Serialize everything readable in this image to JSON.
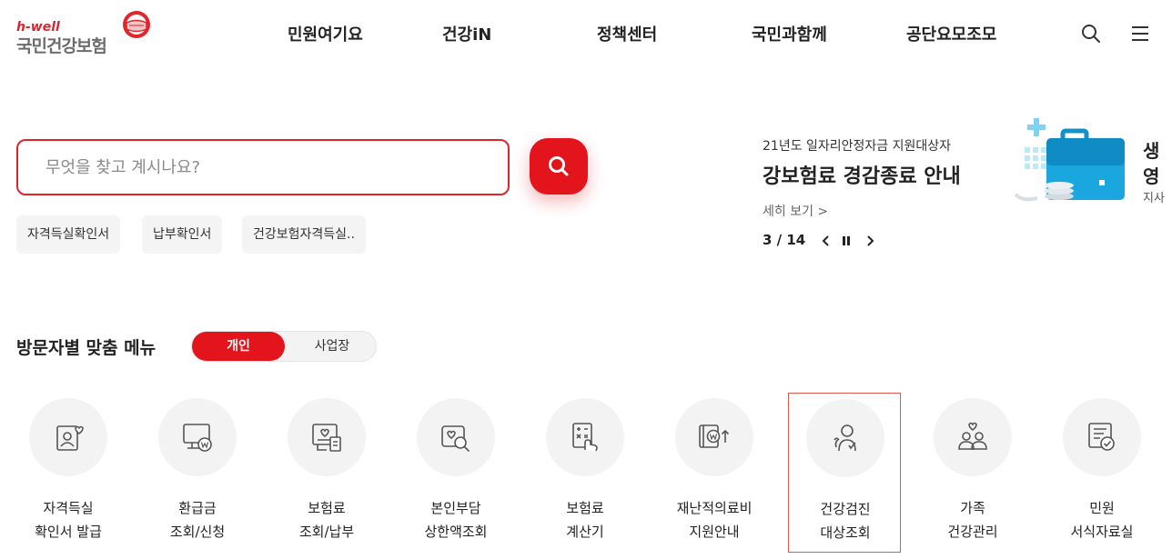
{
  "header": {
    "logo_small": "h-well",
    "logo_main": "국민건강보험",
    "nav": [
      "민원여기요",
      "건강iN",
      "정책센터",
      "국민과함께",
      "공단요모조모"
    ],
    "icons": [
      "search-icon",
      "menu-icon"
    ]
  },
  "search": {
    "placeholder": "무엇을 찾고 계시나요?",
    "value": "",
    "chips": [
      "자격득실확인서",
      "납부확인서",
      "건강보험자격득실.."
    ]
  },
  "banner": {
    "subtitle": "21년도 일자리안정자금 지원대상자",
    "title": "강보험료 경감종료 안내",
    "more": "세히 보기 >",
    "page": "3 / 14",
    "right_title_1": "생",
    "right_title_2": "영",
    "right_sub": "지사"
  },
  "visitor_menu": {
    "title": "방문자별 맞춤 메뉴",
    "tabs": [
      "개인",
      "사업장"
    ],
    "active_tab": "개인",
    "tiles": [
      {
        "line1": "자격득실",
        "line2": "확인서 발급",
        "icon": "id-card-heart-icon"
      },
      {
        "line1": "환급금",
        "line2": "조회/신청",
        "icon": "monitor-won-icon"
      },
      {
        "line1": "보험료",
        "line2": "조회/납부",
        "icon": "invoice-heart-icon"
      },
      {
        "line1": "본인부담",
        "line2": "상한액조회",
        "icon": "heart-search-icon"
      },
      {
        "line1": "보험료",
        "line2": "계산기",
        "icon": "calculator-hand-icon"
      },
      {
        "line1": "재난적의료비",
        "line2": "지원안내",
        "icon": "won-support-icon"
      },
      {
        "line1": "건강검진",
        "line2": "대상조회",
        "icon": "people-check-icon"
      },
      {
        "line1": "가족",
        "line2": "건강관리",
        "icon": "family-heart-icon"
      },
      {
        "line1": "민원",
        "line2": "서식자료실",
        "icon": "document-check-icon"
      }
    ],
    "selected_tile": "건강검진"
  },
  "colors": {
    "accent": "#e3141c",
    "tile_bg": "#f3f3f3",
    "selected_border": "#e0584f"
  }
}
